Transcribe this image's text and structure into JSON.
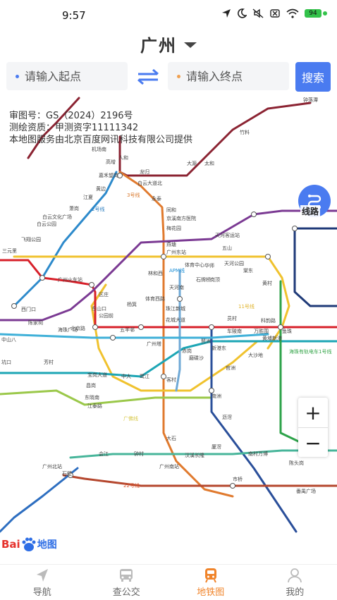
{
  "status_bar": {
    "time": "9:57",
    "battery": "94",
    "icons": [
      "location-icon",
      "moon-icon",
      "mute-icon",
      "sim-off-icon",
      "wifi-icon",
      "battery-icon"
    ]
  },
  "header": {
    "city": "广州"
  },
  "route": {
    "start_placeholder": "请输入起点",
    "end_placeholder": "请输入终点",
    "search_label": "搜索",
    "start_dot_color": "#4a7bf0",
    "end_dot_color": "#f0a050"
  },
  "map": {
    "caption": {
      "line1": "审图号：GS（2024）2196号",
      "line2": "测绘资质：甲测资字11111342",
      "line3": "本地图服务由北京百度网讯科技有限公司提供"
    },
    "line_button_label": "线路",
    "zoom_in": "+",
    "zoom_out": "−",
    "logo": {
      "text": "Bai",
      "text2": "地图"
    },
    "line_labels": [
      {
        "text": "3号线",
        "color": "#d9792e"
      },
      {
        "text": "2号线",
        "color": "#2d7ebf"
      },
      {
        "text": "APM线",
        "color": "#1d8fd6"
      },
      {
        "text": "11号线",
        "color": "#e0b32a"
      },
      {
        "text": "海珠有轨电车1号线",
        "color": "#36a54a"
      },
      {
        "text": "广佛线",
        "color": "#d8c94a"
      },
      {
        "text": "22号线",
        "color": "#d9552e"
      }
    ],
    "stations": [
      "嘉禾望岗",
      "白云大道北",
      "永泰",
      "同和",
      "京溪南方医院",
      "梅花园",
      "燕塘",
      "天河客运站",
      "广州东站",
      "体育中心",
      "林和西",
      "天河南",
      "珠江新城",
      "花城大道",
      "广州塔",
      "客村",
      "大石",
      "汉溪长隆",
      "广州南站",
      "体育西路",
      "公园前",
      "西门口",
      "陈家祠",
      "中山八",
      "坑口",
      "芳村",
      "广州火车站",
      "三元里",
      "飞翔公园",
      "白云公园",
      "白云文化广场",
      "萧岗",
      "江夏",
      "黄边",
      "人和",
      "龙归",
      "高增",
      "机场南",
      "大源",
      "太和",
      "竹料",
      "钟落潭",
      "北京路",
      "东山口",
      "区庄",
      "五羊邨",
      "杨箕",
      "员村",
      "科韵路",
      "车陂南",
      "万胜围",
      "黄埔新港",
      "鱼珠",
      "大沙地",
      "官洲",
      "南洲",
      "沥滘",
      "厦滘",
      "东晓南",
      "昌岗",
      "江泰路",
      "宝岗大道",
      "海珠广场",
      "中大",
      "鹭江",
      "琶洲",
      "新港东",
      "赤岗",
      "磨碟沙",
      "石牌桥",
      "岗顶",
      "华师",
      "五山",
      "天河公园",
      "棠东",
      "黄村",
      "番禺广场",
      "市桥",
      "石壁",
      "会江",
      "钟村",
      "南村万博",
      "陈头岗",
      "广州北站"
    ]
  },
  "bottom_nav": {
    "items": [
      {
        "label": "导航",
        "active": false
      },
      {
        "label": "查公交",
        "active": false
      },
      {
        "label": "地铁图",
        "active": true
      },
      {
        "label": "我的",
        "active": false
      }
    ],
    "active_color": "#f0842a"
  }
}
